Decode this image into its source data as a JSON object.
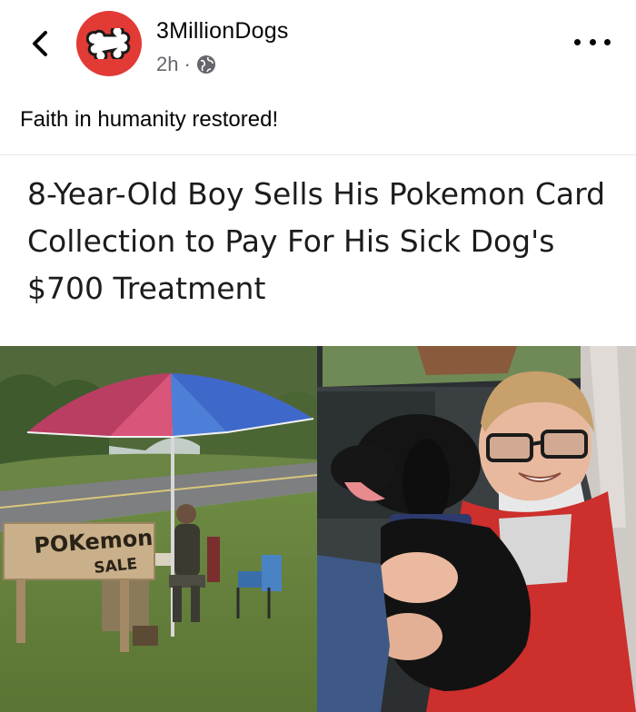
{
  "post": {
    "page_name": "3MillionDogs",
    "time": "2h",
    "separator": "·",
    "caption": "Faith in humanity restored!"
  },
  "article": {
    "headline": "8-Year-Old Boy Sells His Pokemon Card Collection to Pay For His Sick Dog's $700 Treatment"
  },
  "photo_left": {
    "sign_line1": "POKemon",
    "sign_line2": "SALE"
  },
  "icons": {
    "back": "chevron-left-icon",
    "avatar": "bone-icon",
    "privacy": "globe-icon",
    "more": "more-horizontal-icon"
  },
  "colors": {
    "avatar_bg": "#e23a35",
    "meta_text": "#65676b",
    "text": "#050505"
  }
}
